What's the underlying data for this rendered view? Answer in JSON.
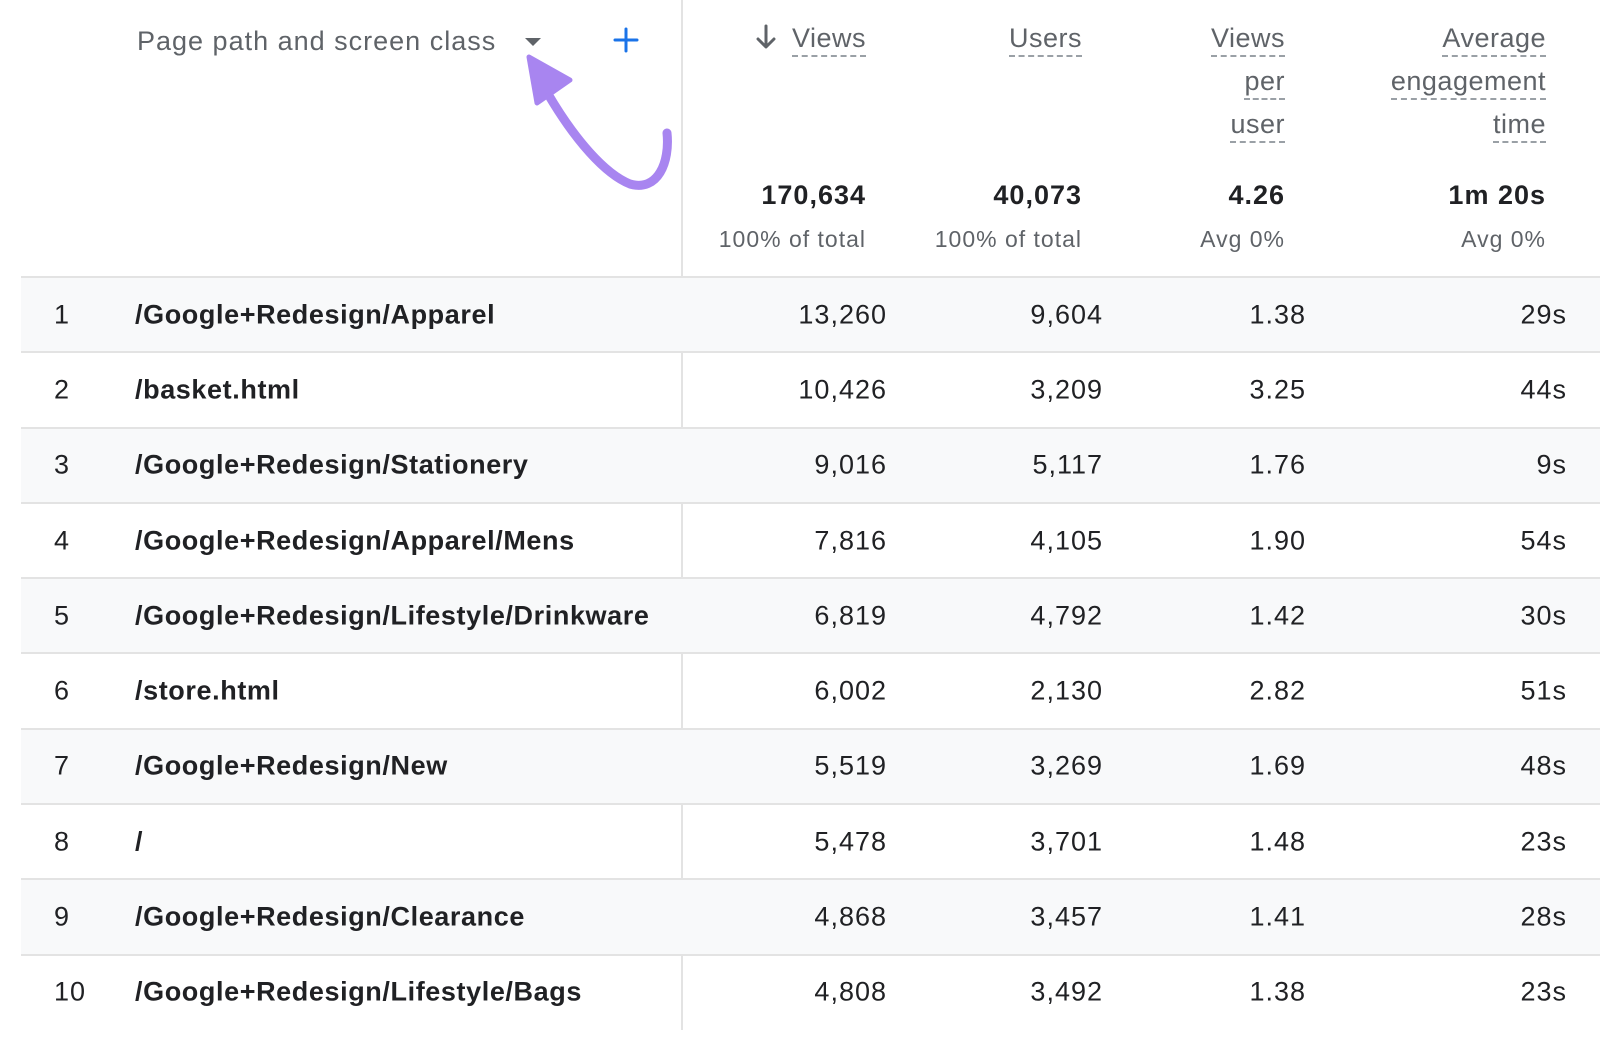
{
  "dimension_header": {
    "label": "Page path and screen class",
    "dropdown_icon": "caret-down-icon",
    "add_icon": "plus-icon"
  },
  "annotation": {
    "color": "#a885f0",
    "icon": "curved-arrow-icon"
  },
  "columns": [
    {
      "key": "views",
      "label_lines": [
        "Views"
      ],
      "sorted": "descending"
    },
    {
      "key": "users",
      "label_lines": [
        "Users"
      ]
    },
    {
      "key": "vpu",
      "label_lines": [
        "Views",
        "per",
        "user"
      ]
    },
    {
      "key": "avg",
      "label_lines": [
        "Average",
        "engagement",
        "time"
      ]
    }
  ],
  "totals": {
    "views": {
      "value": "170,634",
      "sub": "100% of total"
    },
    "users": {
      "value": "40,073",
      "sub": "100% of total"
    },
    "vpu": {
      "value": "4.26",
      "sub": "Avg 0%"
    },
    "avg": {
      "value": "1m 20s",
      "sub": "Avg 0%"
    }
  },
  "rows": [
    {
      "num": "1",
      "path": "/Google+Redesign/Apparel",
      "views": "13,260",
      "users": "9,604",
      "vpu": "1.38",
      "avg": "29s"
    },
    {
      "num": "2",
      "path": "/basket.html",
      "views": "10,426",
      "users": "3,209",
      "vpu": "3.25",
      "avg": "44s"
    },
    {
      "num": "3",
      "path": "/Google+Redesign/Stationery",
      "views": "9,016",
      "users": "5,117",
      "vpu": "1.76",
      "avg": "9s"
    },
    {
      "num": "4",
      "path": "/Google+Redesign/Apparel/Mens",
      "views": "7,816",
      "users": "4,105",
      "vpu": "1.90",
      "avg": "54s"
    },
    {
      "num": "5",
      "path": "/Google+Redesign/Lifestyle/Drinkware",
      "views": "6,819",
      "users": "4,792",
      "vpu": "1.42",
      "avg": "30s"
    },
    {
      "num": "6",
      "path": "/store.html",
      "views": "6,002",
      "users": "2,130",
      "vpu": "2.82",
      "avg": "51s"
    },
    {
      "num": "7",
      "path": "/Google+Redesign/New",
      "views": "5,519",
      "users": "3,269",
      "vpu": "1.69",
      "avg": "48s"
    },
    {
      "num": "8",
      "path": "/",
      "views": "5,478",
      "users": "3,701",
      "vpu": "1.48",
      "avg": "23s"
    },
    {
      "num": "9",
      "path": "/Google+Redesign/Clearance",
      "views": "4,868",
      "users": "3,457",
      "vpu": "1.41",
      "avg": "28s"
    },
    {
      "num": "10",
      "path": "/Google+Redesign/Lifestyle/Bags",
      "views": "4,808",
      "users": "3,492",
      "vpu": "1.38",
      "avg": "23s"
    }
  ]
}
